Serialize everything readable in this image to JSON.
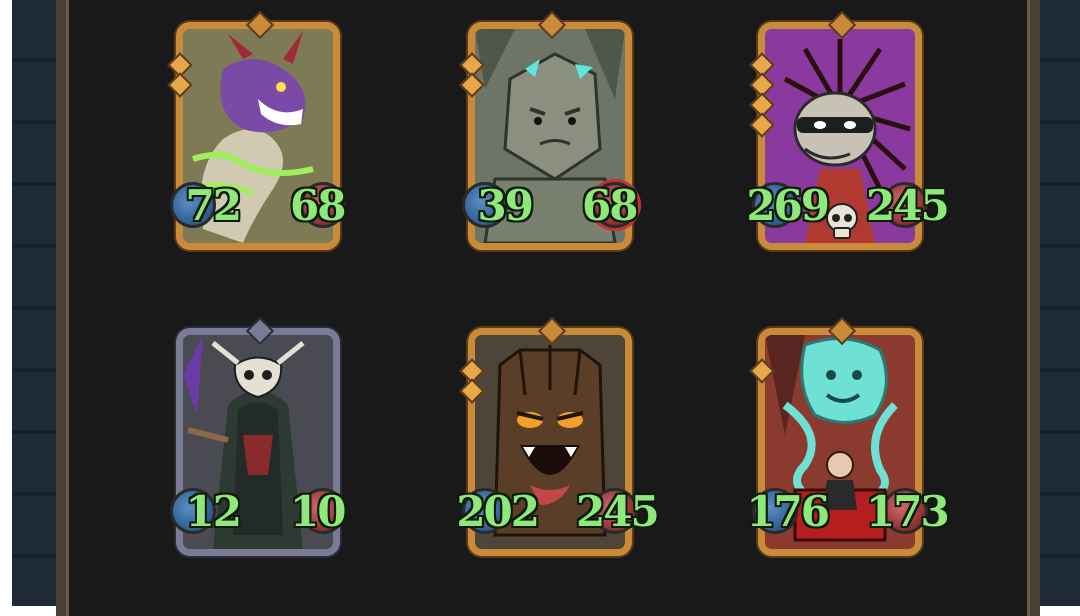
{
  "cards": [
    {
      "name": "serpent-dragon",
      "attack": "72",
      "health": "68",
      "frame": "gold",
      "gems": 2,
      "bg": "#7d7a55",
      "hp_spiked": false
    },
    {
      "name": "stone-golem",
      "attack": "39",
      "health": "68",
      "frame": "gold",
      "gems": 2,
      "bg": "#6e7566",
      "hp_spiked": true
    },
    {
      "name": "masked-hedgehog",
      "attack": "269",
      "health": "245",
      "frame": "gold",
      "gems": 4,
      "bg": "#8a3a9e",
      "hp_spiked": false,
      "skull": true
    },
    {
      "name": "skull-shaman",
      "attack": "12",
      "health": "10",
      "frame": "silver",
      "gems": 0,
      "bg": "#4a4b52",
      "hp_spiked": false
    },
    {
      "name": "wooden-totem",
      "attack": "202",
      "health": "245",
      "frame": "gold",
      "gems": 2,
      "bg": "#4e4538",
      "hp_spiked": false
    },
    {
      "name": "spirit-summoner",
      "attack": "176",
      "health": "173",
      "frame": "gold",
      "gems": 1,
      "bg": "#8a3a2e",
      "hp_spiked": false
    }
  ],
  "colors": {
    "stat_text": "#8ee87a",
    "gold_frame": "#c98a3a",
    "silver_frame": "#7a7c96"
  }
}
